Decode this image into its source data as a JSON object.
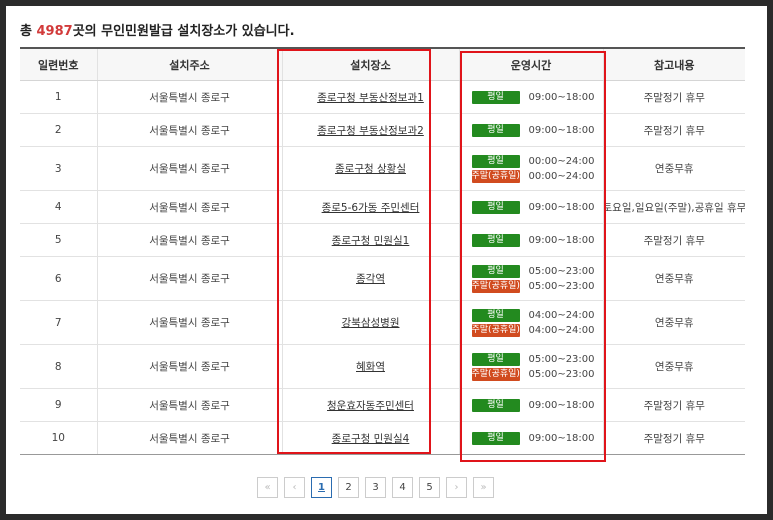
{
  "summary": {
    "prefix": "총 ",
    "count": "4987",
    "suffix": "곳의 무인민원발급 설치장소가 있습니다."
  },
  "columns": [
    "일련번호",
    "설치주소",
    "설치장소",
    "운영시간",
    "참고내용"
  ],
  "badges": {
    "weekday": "평일",
    "holiday": "주말(공휴일)"
  },
  "rows": [
    {
      "no": "1",
      "address": "서울특별시 종로구",
      "place": "종로구청 부동산정보과1",
      "hours": [
        {
          "type": "weekday",
          "time": "09:00~18:00"
        }
      ],
      "note": "주말정기 휴무"
    },
    {
      "no": "2",
      "address": "서울특별시 종로구",
      "place": "종로구청 부동산정보과2",
      "hours": [
        {
          "type": "weekday",
          "time": "09:00~18:00"
        }
      ],
      "note": "주말정기 휴무"
    },
    {
      "no": "3",
      "address": "서울특별시 종로구",
      "place": "종로구청 상황실",
      "hours": [
        {
          "type": "weekday",
          "time": "00:00~24:00"
        },
        {
          "type": "holiday",
          "time": "00:00~24:00"
        }
      ],
      "note": "연중무휴"
    },
    {
      "no": "4",
      "address": "서울특별시 종로구",
      "place": "종로5-6가동 주민센터",
      "hours": [
        {
          "type": "weekday",
          "time": "09:00~18:00"
        }
      ],
      "note": "토요일,일요일(주말),공휴일 휴무"
    },
    {
      "no": "5",
      "address": "서울특별시 종로구",
      "place": "종로구청 민원실1",
      "hours": [
        {
          "type": "weekday",
          "time": "09:00~18:00"
        }
      ],
      "note": "주말정기 휴무"
    },
    {
      "no": "6",
      "address": "서울특별시 종로구",
      "place": "종각역",
      "hours": [
        {
          "type": "weekday",
          "time": "05:00~23:00"
        },
        {
          "type": "holiday",
          "time": "05:00~23:00"
        }
      ],
      "note": "연중무휴"
    },
    {
      "no": "7",
      "address": "서울특별시 종로구",
      "place": "강북삼성병원",
      "hours": [
        {
          "type": "weekday",
          "time": "04:00~24:00"
        },
        {
          "type": "holiday",
          "time": "04:00~24:00"
        }
      ],
      "note": "연중무휴"
    },
    {
      "no": "8",
      "address": "서울특별시 종로구",
      "place": "혜화역",
      "hours": [
        {
          "type": "weekday",
          "time": "05:00~23:00"
        },
        {
          "type": "holiday",
          "time": "05:00~23:00"
        }
      ],
      "note": "연중무휴"
    },
    {
      "no": "9",
      "address": "서울특별시 종로구",
      "place": "청운효자동주민센터",
      "hours": [
        {
          "type": "weekday",
          "time": "09:00~18:00"
        }
      ],
      "note": "주말정기 휴무"
    },
    {
      "no": "10",
      "address": "서울특별시 종로구",
      "place": "종로구청 민원실4",
      "hours": [
        {
          "type": "weekday",
          "time": "09:00~18:00"
        }
      ],
      "note": "주말정기 휴무"
    }
  ],
  "pagination": {
    "first": "«",
    "prev": "‹",
    "pages": [
      "1",
      "2",
      "3",
      "4",
      "5"
    ],
    "active": "1",
    "next": "›",
    "last": "»"
  }
}
